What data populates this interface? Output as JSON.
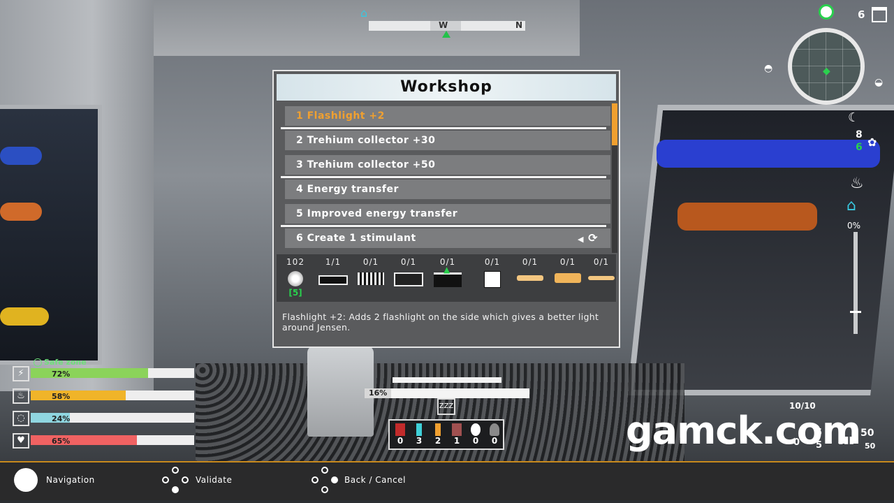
{
  "compass": {
    "w": "W",
    "n": "N"
  },
  "workshop": {
    "title": "Workshop",
    "items": [
      {
        "label": "1 Flashlight +2"
      },
      {
        "label": "2 Trehium collector +30"
      },
      {
        "label": "3 Trehium collector +50"
      },
      {
        "label": "4 Energy transfer"
      },
      {
        "label": "5 Improved energy transfer"
      },
      {
        "label": "6 Create 1 stimulant"
      }
    ],
    "resources": [
      {
        "count": "102",
        "sub": "[5]",
        "icon": "ore-icon"
      },
      {
        "count": "1/1",
        "icon": "part-bar-icon"
      },
      {
        "count": "0/1",
        "icon": "part-striped-icon"
      },
      {
        "count": "0/1",
        "icon": "part-panel-icon"
      },
      {
        "count": "0/1",
        "icon": "machine-up-icon"
      },
      {
        "count": "0/1",
        "icon": "white-square-icon"
      },
      {
        "count": "0/1",
        "icon": "gold-bar-icon"
      },
      {
        "count": "0/1",
        "icon": "gold-block-icon"
      },
      {
        "count": "0/1",
        "icon": "gold-tube-icon"
      }
    ],
    "description": "Flashlight +2: Adds 2 flashlight on the side which gives a better light around Jensen."
  },
  "hud_right": {
    "day": "6",
    "stat_a": "8",
    "stat_b": "6",
    "heat_pct": "0%"
  },
  "stats": {
    "safe_zone": "Safe zone",
    "rows": [
      {
        "pct_label": "72%",
        "value": 0.72,
        "color": "#8bd35a",
        "icon": "energy-icon"
      },
      {
        "pct_label": "58%",
        "value": 0.58,
        "color": "#f0b429",
        "icon": "food-icon"
      },
      {
        "pct_label": "24%",
        "value": 0.24,
        "color": "#8fd6e0",
        "icon": "oxygen-icon"
      },
      {
        "pct_label": "65%",
        "value": 0.65,
        "color": "#f06262",
        "icon": "health-icon"
      }
    ]
  },
  "center": {
    "progress_label": "16%",
    "progress": 0.16,
    "zzz": "ZZZ"
  },
  "inventory": [
    {
      "num": "0",
      "color": "#c22b2b",
      "icon": "medkit-icon"
    },
    {
      "num": "3",
      "color": "#3fd0d8",
      "icon": "vial-icon"
    },
    {
      "num": "2",
      "color": "#f0a030",
      "icon": "battery-icon"
    },
    {
      "num": "1",
      "color": "#a05050",
      "icon": "jar-icon"
    },
    {
      "num": "0",
      "color": "#ffffff",
      "icon": "orb-icon"
    },
    {
      "num": "0",
      "color": "#8a8a8a",
      "icon": "joystick-icon"
    }
  ],
  "ammo": {
    "clip": "10/10",
    "reserve": "50",
    "reserve2": "50",
    "mid_a": "5",
    "mid_b": "5",
    "left": "0"
  },
  "watermark": "gamck.com",
  "controls": {
    "navigation": "Navigation",
    "validate": "Validate",
    "back": "Back / Cancel"
  }
}
